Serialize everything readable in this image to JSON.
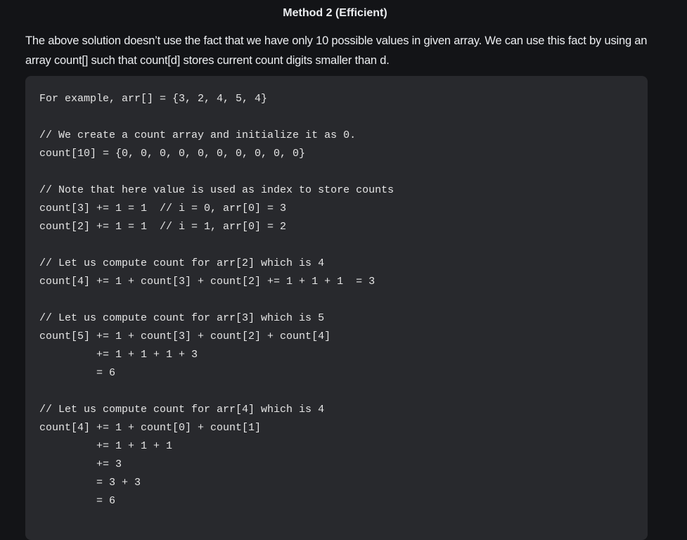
{
  "heading": "Method 2 (Efficient)",
  "paragraph": "The above solution doesn’t use the fact that we have only 10 possible values in given array. We can use this fact by using an array count[] such that count[d] stores current count digits smaller than d.",
  "code_lines": [
    "For example, arr[] = {3, 2, 4, 5, 4}",
    "",
    "// We create a count array and initialize it as 0.",
    "count[10] = {0, 0, 0, 0, 0, 0, 0, 0, 0, 0}",
    "",
    "// Note that here value is used as index to store counts",
    "count[3] += 1 = 1  // i = 0, arr[0] = 3",
    "count[2] += 1 = 1  // i = 1, arr[0] = 2",
    "",
    "// Let us compute count for arr[2] which is 4",
    "count[4] += 1 + count[3] + count[2] += 1 + 1 + 1  = 3",
    "",
    "// Let us compute count for arr[3] which is 5",
    "count[5] += 1 + count[3] + count[2] + count[4]",
    "         += 1 + 1 + 1 + 3",
    "         = 6",
    "",
    "// Let us compute count for arr[4] which is 4",
    "count[4] += 1 + count[0] + count[1]",
    "         += 1 + 1 + 1",
    "         += 3",
    "         = 3 + 3",
    "         = 6"
  ]
}
